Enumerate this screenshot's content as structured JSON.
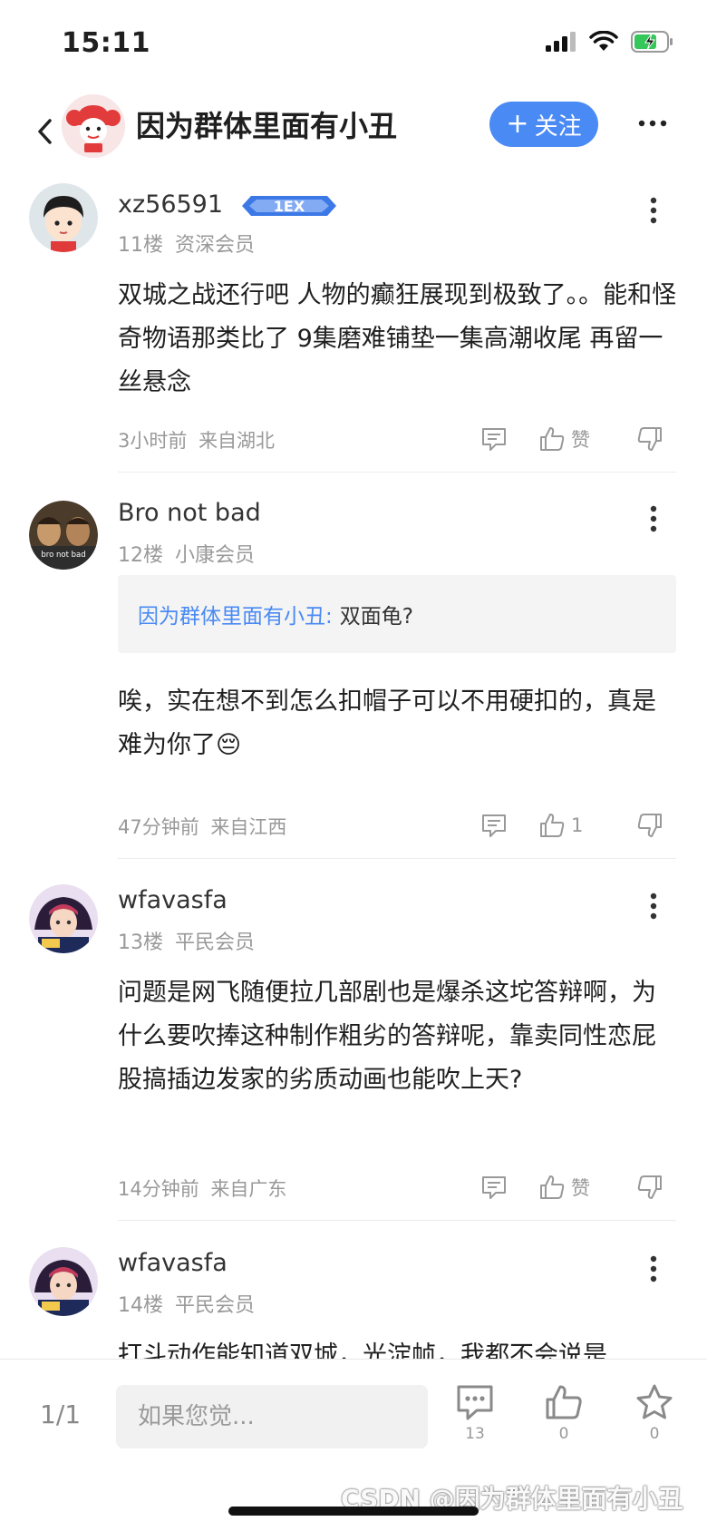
{
  "status_bar": {
    "time": "15:11"
  },
  "header": {
    "title": "因为群体里面有小丑",
    "follow_label": "关注",
    "follow_plus": "+"
  },
  "posts": [
    {
      "username": "xz56591",
      "badge_text": "1EX",
      "floor": "11楼",
      "member": "资深会员",
      "content": "双城之战还行吧 人物的癫狂展现到极致了。。能和怪奇物语那类比了 9集磨难铺垫一集高潮收尾 再留一丝悬念",
      "time": "3小时前",
      "location": "来自湖北",
      "like_label": "赞"
    },
    {
      "username": "Bro not bad",
      "avatar_text": "bro not bad",
      "floor": "12楼",
      "member": "小康会员",
      "quote_name": "因为群体里面有小丑:",
      "quote_text": "双面龟?",
      "content": "唉，实在想不到怎么扣帽子可以不用硬扣的，真是难为你了😔",
      "time": "47分钟前",
      "location": "来自江西",
      "like_label": "1"
    },
    {
      "username": "wfavasfa",
      "floor": "13楼",
      "member": "平民会员",
      "content": "问题是网飞随便拉几部剧也是爆杀这坨答辩啊，为什么要吹捧这种制作粗劣的答辩呢，靠卖同性恋屁股搞插边发家的劣质动画也能吹上天?",
      "time": "14分钟前",
      "location": "来自广东",
      "like_label": "赞"
    },
    {
      "username": "wfavasfa",
      "floor": "14楼",
      "member": "平民会员",
      "content": "打斗动作能知道双城，光淀帧，我都不会说是"
    }
  ],
  "bottom_bar": {
    "page": "1/1",
    "input_placeholder": "如果您觉...",
    "comment_count": "13",
    "like_count": "0",
    "star_count": "0"
  },
  "watermark": "CSDN @因为群体里面有小丑",
  "colors": {
    "accent": "#4a8af4",
    "meta": "#999999"
  }
}
